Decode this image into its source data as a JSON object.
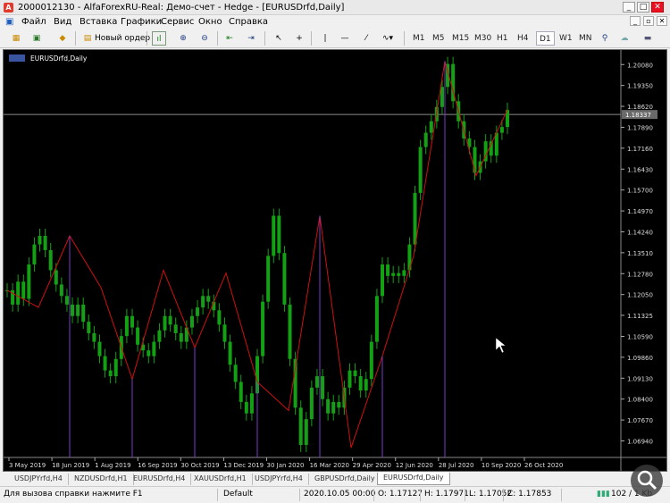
{
  "window": {
    "title": "2000012130 - AlfaForexRU-Real: Демо-счет - Hedge - [EURUSDrfd,Daily]",
    "minimize": "_",
    "maximize": "□",
    "close": "✕"
  },
  "menu": [
    "Файл",
    "Вид",
    "Вставка",
    "Графики",
    "Сервис",
    "Окно",
    "Справка"
  ],
  "toolbar": {
    "new_order": "Новый ордер",
    "timeframes": [
      "M1",
      "M5",
      "M15",
      "M30",
      "H1",
      "H4",
      "D1",
      "W1",
      "MN"
    ],
    "active_timeframe": "D1"
  },
  "chart": {
    "label": "EURUSDrfd,Daily",
    "current_price": "1.18337",
    "price_labels": [
      "1.20080",
      "1.19350",
      "1.18620",
      "1.17890",
      "1.17160",
      "1.16430",
      "1.15700",
      "1.14970",
      "1.14240",
      "1.13510",
      "1.12780",
      "1.12050",
      "1.11325",
      "1.10590",
      "1.09860",
      "1.09130",
      "1.08400",
      "1.07670",
      "1.06940"
    ],
    "date_labels": [
      "3 May 2019",
      "18 Jun 2019",
      "1 Aug 2019",
      "16 Sep 2019",
      "30 Oct 2019",
      "13 Dec 2019",
      "30 Jan 2020",
      "16 Mar 2020",
      "29 Apr 2020",
      "12 Jun 2020",
      "28 Jul 2020",
      "10 Sep 2020",
      "26 Oct 2020"
    ],
    "colors": {
      "background": "#000000",
      "candles": "#14a014",
      "zigzag": "#d01010",
      "markers": "#7a3cc8",
      "price_line": "#8a8a8a"
    }
  },
  "chart_data": {
    "type": "line",
    "title": "EURUSDrfd,Daily",
    "xlabel": "",
    "ylabel": "",
    "ylim": [
      1.0655,
      1.204
    ],
    "series": [
      {
        "name": "price",
        "values": [
          1.122,
          1.117,
          1.125,
          1.119,
          1.131,
          1.138,
          1.141,
          1.136,
          1.129,
          1.124,
          1.12,
          1.117,
          1.113,
          1.117,
          1.111,
          1.107,
          1.104,
          1.099,
          1.094,
          1.092,
          1.098,
          1.106,
          1.113,
          1.109,
          1.103,
          1.101,
          1.099,
          1.104,
          1.108,
          1.113,
          1.11,
          1.107,
          1.104,
          1.109,
          1.113,
          1.116,
          1.12,
          1.118,
          1.115,
          1.11,
          1.104,
          1.096,
          1.09,
          1.083,
          1.079,
          1.086,
          1.099,
          1.118,
          1.134,
          1.148,
          1.135,
          1.117,
          1.098,
          1.081,
          1.068,
          1.077,
          1.088,
          1.092,
          1.084,
          1.079,
          1.083,
          1.081,
          1.088,
          1.094,
          1.092,
          1.087,
          1.091,
          1.104,
          1.12,
          1.131,
          1.127,
          1.128,
          1.127,
          1.129,
          1.138,
          1.156,
          1.172,
          1.177,
          1.181,
          1.186,
          1.193,
          1.201,
          1.188,
          1.181,
          1.175,
          1.172,
          1.163,
          1.167,
          1.174,
          1.169,
          1.177,
          1.179,
          1.185
        ]
      },
      {
        "name": "zigzag",
        "values": [
          1.122,
          1.116,
          1.141,
          1.123,
          1.091,
          1.129,
          1.102,
          1.128,
          1.09,
          1.08,
          1.148,
          1.067,
          1.099,
          1.134,
          1.202,
          1.162,
          1.185
        ]
      }
    ]
  },
  "tabs": [
    "USDJPYrfd,H4",
    "NZDUSDrfd,H1",
    "EURUSDrfd,H4",
    "XAUUSDrfd,H1",
    "USDJPYrfd,H4",
    "GBPUSDrfd,Daily",
    "EURUSDrfd,Daily"
  ],
  "active_tab": "EURUSDrfd,Daily",
  "status": {
    "help": "Для вызова справки нажмите F1",
    "profile": "Default",
    "datetime": "2020.10.05 00:00",
    "open": "O: 1.17127",
    "high": "H: 1.17971",
    "low": "L: 1.17052",
    "close": "C: 1.17853",
    "traffic": "102 / 1 Kb"
  }
}
